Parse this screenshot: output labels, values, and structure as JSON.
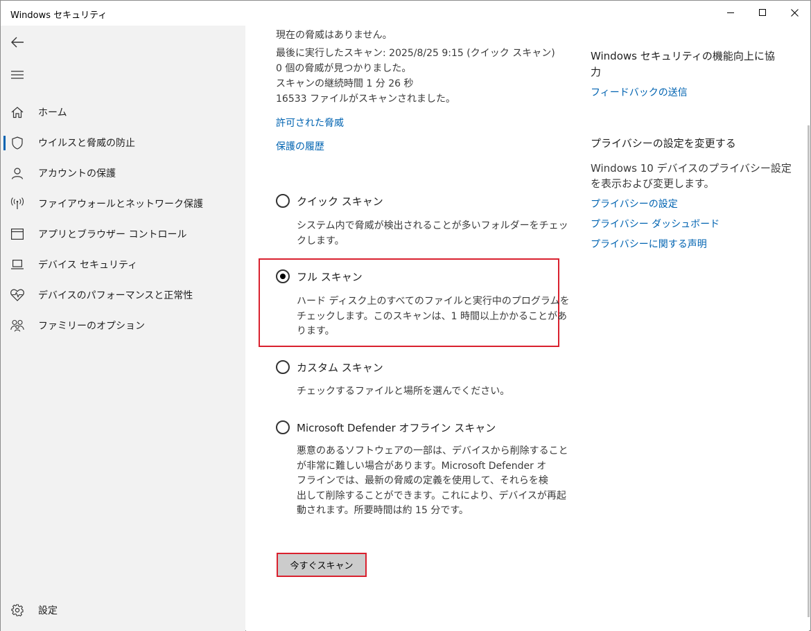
{
  "window": {
    "title": "Windows セキュリティ"
  },
  "sidebar": {
    "items": [
      {
        "label": "ホーム",
        "icon": "home-icon"
      },
      {
        "label": "ウイルスと脅威の防止",
        "icon": "shield-icon",
        "active": true
      },
      {
        "label": "アカウントの保護",
        "icon": "person-icon"
      },
      {
        "label": "ファイアウォールとネットワーク保護",
        "icon": "antenna-icon"
      },
      {
        "label": "アプリとブラウザー コントロール",
        "icon": "browser-window-icon"
      },
      {
        "label": "デバイス セキュリティ",
        "icon": "laptop-icon"
      },
      {
        "label": "デバイスのパフォーマンスと正常性",
        "icon": "heart-pulse-icon"
      },
      {
        "label": "ファミリーのオプション",
        "icon": "family-icon"
      }
    ],
    "settings_label": "設定"
  },
  "scan_status": {
    "no_threats": "現在の脅威はありません。",
    "last_scan": "最後に実行したスキャン: 2025/8/25 9:15 (クイック スキャン)",
    "threats_found": "0 個の脅威が見つかりました。",
    "duration": "スキャンの継続時間 1 分 26 秒",
    "files_scanned": "16533 ファイルがスキャンされました。"
  },
  "links": {
    "allowed_threats": "許可された脅威",
    "protection_history": "保護の履歴"
  },
  "scan_options": [
    {
      "label": "クイック スキャン",
      "checked": false,
      "desc": [
        "システム内で脅威が検出されることが多いフォルダーをチェッ",
        "クします。"
      ]
    },
    {
      "label": "フル スキャン",
      "checked": true,
      "desc": [
        "ハード ディスク上のすべてのファイルと実行中のプログラムを",
        "チェックします。このスキャンは、1 時間以上かかることがあ",
        "ります。"
      ]
    },
    {
      "label": "カスタム スキャン",
      "checked": false,
      "desc": [
        "チェックするファイルと場所を選んでください。"
      ]
    },
    {
      "label": "Microsoft Defender オフライン スキャン",
      "checked": false,
      "desc": [
        "悪意のあるソフトウェアの一部は、デバイスから削除すること",
        "が非常に難しい場合があります。Microsoft Defender オ",
        "フラインでは、最新の脅威の定義を使用して、それらを検",
        "出して削除することができます。これにより、デバイスが再起",
        "動されます。所要時間は約 15 分です。"
      ]
    }
  ],
  "scan_now_button": "今すぐスキャン",
  "right_panel": {
    "feedback_heading_line1": "Windows セキュリティの機能向上に協",
    "feedback_heading_line2": "力",
    "feedback_link": "フィードバックの送信",
    "privacy_heading": "プライバシーの設定を変更する",
    "privacy_desc_line1": "Windows 10 デバイスのプライバシー設定",
    "privacy_desc_line2": "を表示および変更します。",
    "privacy_settings_link": "プライバシーの設定",
    "privacy_dashboard_link": "プライバシー ダッシュボード",
    "privacy_statement_link": "プライバシーに関する声明"
  },
  "colors": {
    "accent": "#0063b1",
    "highlight": "#d9202e",
    "sidebar_bg": "#f2f2f2"
  }
}
